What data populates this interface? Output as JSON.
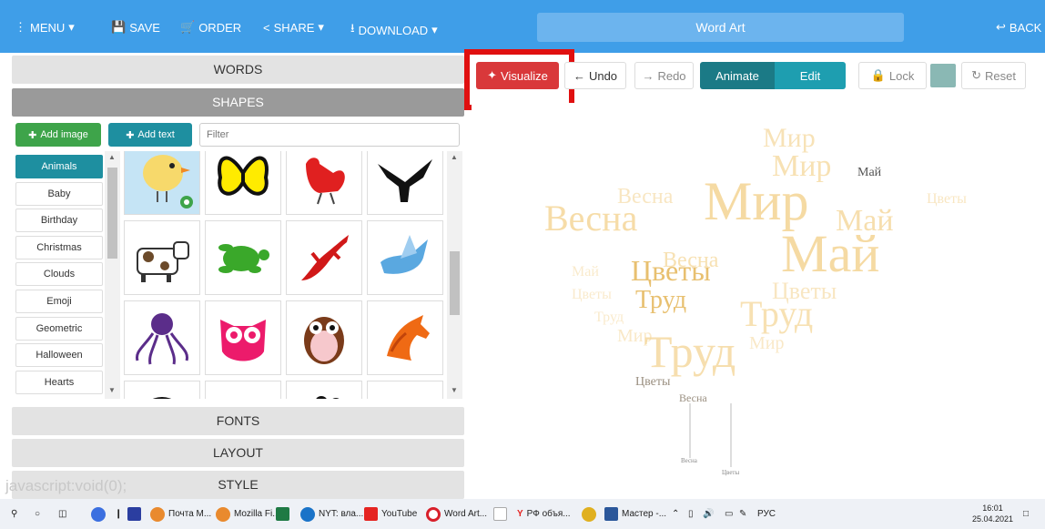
{
  "topbar": {
    "menu_label": "MENU",
    "save_label": "SAVE",
    "order_label": "ORDER",
    "share_label": "SHARE",
    "download_label": "DOWNLOAD",
    "title": "Word Art",
    "back_label": "BACK",
    "background_color": "#3f9ee8"
  },
  "left_panel": {
    "sections": {
      "words": "WORDS",
      "shapes": "SHAPES",
      "fonts": "FONTS",
      "layout": "LAYOUT",
      "style": "STYLE"
    },
    "add_image_label": "Add image",
    "add_text_label": "Add text",
    "filter_placeholder": "Filter",
    "categories": [
      "Animals",
      "Baby",
      "Birthday",
      "Christmas",
      "Clouds",
      "Emoji",
      "Geometric",
      "Halloween",
      "Hearts"
    ],
    "selected_category": "Animals",
    "shapes": [
      "chick",
      "butterfly",
      "rooster",
      "eagle",
      "cow",
      "turtle",
      "lizard",
      "dove",
      "octopus",
      "owl-pink",
      "owl",
      "horse",
      "ladybug",
      "fox",
      "paw",
      "bird"
    ],
    "selected_shape": "chick"
  },
  "toolbar": {
    "visualize_label": "Visualize",
    "undo_label": "Undo",
    "redo_label": "Redo",
    "animate_label": "Animate",
    "edit_label": "Edit",
    "lock_label": "Lock",
    "reset_label": "Reset",
    "swatch_color": "#8ab8b4",
    "highlight_color": "#e01010"
  },
  "canvas": {
    "words": [
      "Мир",
      "Май",
      "Весна",
      "Труд",
      "Цветы"
    ],
    "word_color": "#f5d79a"
  },
  "status_bar": {
    "link_text": "javascript:void(0);"
  },
  "taskbar": {
    "items": [
      "Почта M...",
      "Mozilla Fi...",
      "NYT: вла...",
      "YouTube",
      "Word Art...",
      "РФ объя...",
      "Мастер -..."
    ],
    "lang": "РУС",
    "time": "16:01",
    "date": "25.04.2021"
  }
}
